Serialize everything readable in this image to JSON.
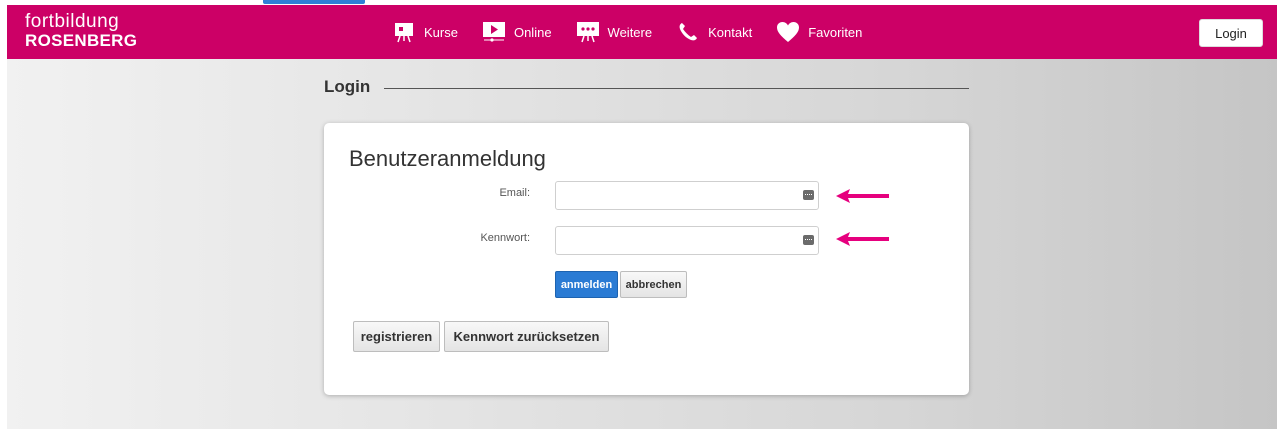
{
  "header": {
    "logo_line1": "fortbildung",
    "logo_line2": "ROSENBERG",
    "nav": [
      {
        "label": "Kurse",
        "icon": "presentation-board-icon"
      },
      {
        "label": "Online",
        "icon": "video-play-icon"
      },
      {
        "label": "Weitere",
        "icon": "presentation-dots-icon"
      },
      {
        "label": "Kontakt",
        "icon": "phone-icon"
      },
      {
        "label": "Favoriten",
        "icon": "heart-icon"
      }
    ],
    "login_label": "Login"
  },
  "page": {
    "title": "Login"
  },
  "card": {
    "title": "Benutzeranmeldung",
    "email_label": "Email:",
    "password_label": "Kennwort:",
    "email_value": "",
    "password_value": "",
    "submit_label": "anmelden",
    "cancel_label": "abbrechen",
    "register_label": "registrieren",
    "reset_label": "Kennwort zurücksetzen"
  },
  "colors": {
    "brand": "#cc0066",
    "primary_button": "#2a7bd4",
    "annotation_arrow": "#e6007e"
  }
}
